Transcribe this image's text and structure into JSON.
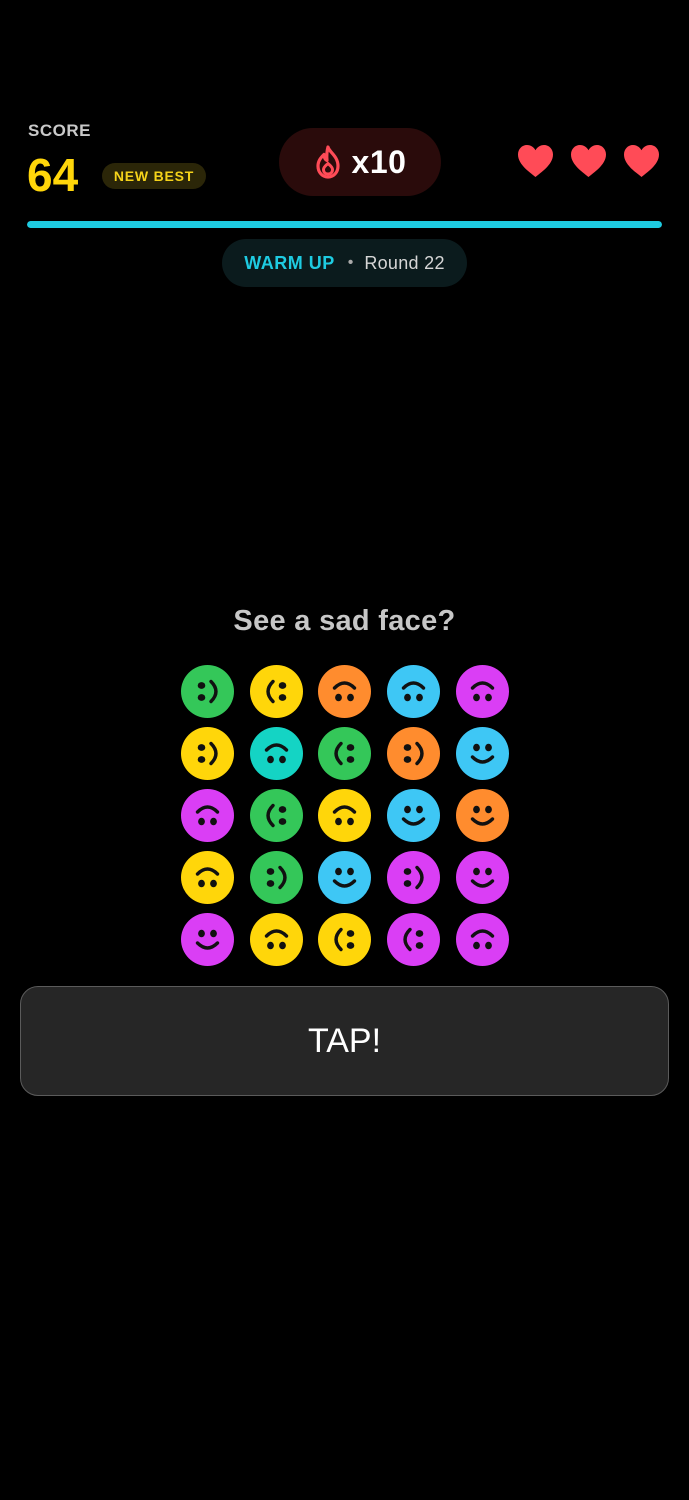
{
  "header": {
    "score_label": "SCORE",
    "score_value": "64",
    "best_badge": "NEW BEST",
    "streak": {
      "icon": "flame-icon",
      "count": "x10",
      "color": "#ff4b57"
    },
    "lives": {
      "count": 3,
      "icon": "heart-icon",
      "color": "#ff4b57"
    },
    "progress": {
      "fraction": 1.0,
      "color": "#1ecbe1"
    }
  },
  "round": {
    "phase": "WARM UP",
    "separator": "•",
    "label": "Round 22",
    "phase_color": "#1ecbe1"
  },
  "prompt": "See a sad face?",
  "colors": {
    "score": "#ffd60a",
    "badge_text": "#f5d31a"
  },
  "grid": {
    "rows": 5,
    "cols": 5,
    "faces": [
      {
        "color": "#34c759",
        "orientation": "left"
      },
      {
        "color": "#ffd60a",
        "orientation": "right"
      },
      {
        "color": "#ff8c2e",
        "orientation": "down"
      },
      {
        "color": "#3ec7f5",
        "orientation": "down"
      },
      {
        "color": "#da3ef5",
        "orientation": "down"
      },
      {
        "color": "#ffd60a",
        "orientation": "left"
      },
      {
        "color": "#14d4c4",
        "orientation": "down"
      },
      {
        "color": "#34c759",
        "orientation": "right"
      },
      {
        "color": "#ff8c2e",
        "orientation": "left"
      },
      {
        "color": "#3ec7f5",
        "orientation": "up"
      },
      {
        "color": "#da3ef5",
        "orientation": "down"
      },
      {
        "color": "#34c759",
        "orientation": "right"
      },
      {
        "color": "#ffd60a",
        "orientation": "down"
      },
      {
        "color": "#3ec7f5",
        "orientation": "up"
      },
      {
        "color": "#ff8c2e",
        "orientation": "up"
      },
      {
        "color": "#ffd60a",
        "orientation": "down"
      },
      {
        "color": "#34c759",
        "orientation": "left"
      },
      {
        "color": "#3ec7f5",
        "orientation": "up"
      },
      {
        "color": "#da3ef5",
        "orientation": "left"
      },
      {
        "color": "#da3ef5",
        "orientation": "up"
      },
      {
        "color": "#da3ef5",
        "orientation": "up"
      },
      {
        "color": "#ffd60a",
        "orientation": "down"
      },
      {
        "color": "#ffd60a",
        "orientation": "right"
      },
      {
        "color": "#da3ef5",
        "orientation": "right"
      },
      {
        "color": "#da3ef5",
        "orientation": "down"
      }
    ]
  },
  "action_button": {
    "label": "TAP!"
  }
}
